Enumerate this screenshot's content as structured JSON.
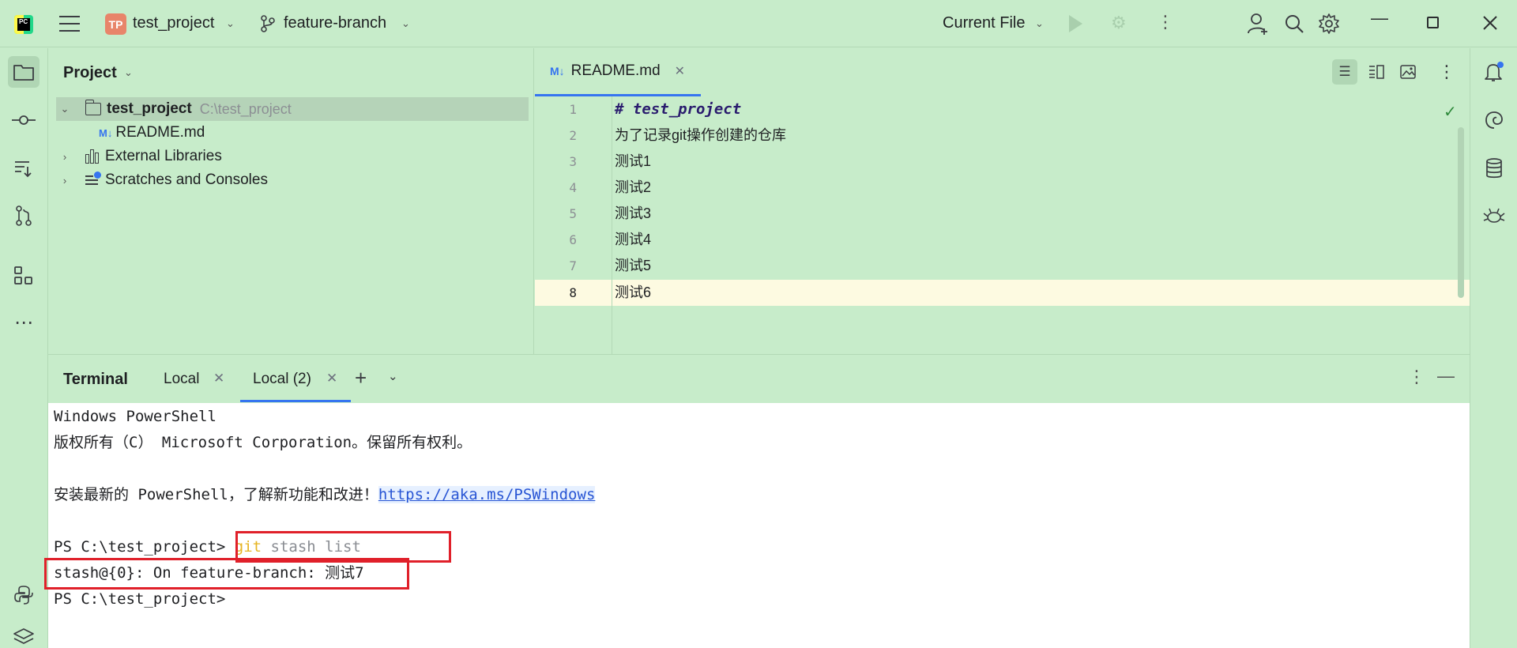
{
  "titlebar": {
    "app_logo_text": "PC",
    "project_badge": "TP",
    "project_name": "test_project",
    "branch_name": "feature-branch",
    "run_config": "Current File"
  },
  "project_panel": {
    "title": "Project",
    "tree": [
      {
        "name": "test_project",
        "path": "C:\\test_project"
      },
      {
        "name": "README.md"
      },
      {
        "name": "External Libraries"
      },
      {
        "name": "Scratches and Consoles"
      }
    ]
  },
  "editor": {
    "tab_label": "README.md",
    "md_icon": "M↓",
    "lines": [
      {
        "num": "1",
        "text": "# test_project"
      },
      {
        "num": "2",
        "text": "为了记录git操作创建的仓库"
      },
      {
        "num": "3",
        "text": "测试1"
      },
      {
        "num": "4",
        "text": "测试2"
      },
      {
        "num": "5",
        "text": "测试3"
      },
      {
        "num": "6",
        "text": "测试4"
      },
      {
        "num": "7",
        "text": "测试5"
      },
      {
        "num": "8",
        "text": "测试6"
      }
    ]
  },
  "terminal": {
    "title": "Terminal",
    "tabs": [
      {
        "label": "Local"
      },
      {
        "label": "Local (2)"
      }
    ],
    "lines": {
      "l1": "Windows PowerShell",
      "l2": "版权所有（C） Microsoft Corporation。保留所有权利。",
      "l4_prefix": "安装最新的 PowerShell，了解新功能和改进！",
      "l4_link": "https://aka.ms/PSWindows",
      "prompt1": "PS C:\\test_project> ",
      "cmd_git": "git",
      "cmd_args": " stash list",
      "stash_line": "stash@{0}: On feature-branch: 测试7",
      "prompt2": "PS C:\\test_project>"
    }
  },
  "colors": {
    "background": "#c7ecca",
    "accent": "#3574f0",
    "highlight_border": "#e0202a",
    "current_line": "#fdfae1"
  }
}
